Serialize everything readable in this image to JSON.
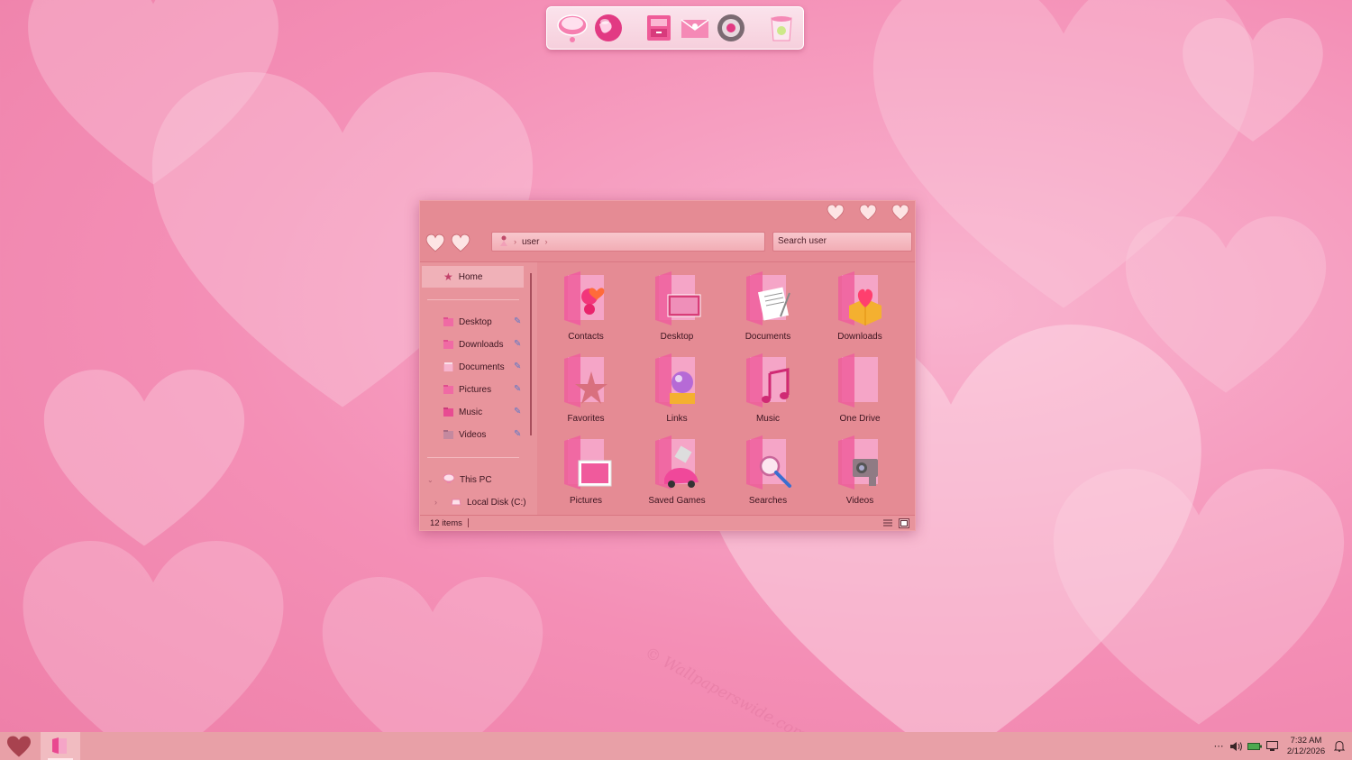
{
  "window": {
    "address": {
      "path": [
        "user"
      ]
    },
    "search": {
      "placeholder": "Search user"
    },
    "sidebar": {
      "home": "Home",
      "quick_access": [
        "Desktop",
        "Downloads",
        "Documents",
        "Pictures",
        "Music",
        "Videos"
      ],
      "this_pc": "This PC",
      "local_disk": "Local Disk (C:)"
    },
    "items": [
      "Contacts",
      "Desktop",
      "Documents",
      "Downloads",
      "Favorites",
      "Links",
      "Music",
      "One Drive",
      "Pictures",
      "Saved Games",
      "Searches",
      "Videos"
    ],
    "status": {
      "count": "12 items"
    }
  },
  "dock": {
    "icons": [
      "chat-icon",
      "globe-icon",
      "cabinet-icon",
      "mail-icon",
      "settings-disc-icon",
      "trash-icon"
    ]
  },
  "taskbar": {
    "tray": {
      "overflow": "⋯",
      "time": "7:32 AM",
      "date": "2/12/2026"
    }
  },
  "wallpaper": {
    "watermark": "© Wallpaperswide.com"
  },
  "colors": {
    "accent": "#e58b94",
    "wallpaper": "#f48fb6",
    "taskbar": "#e8a0a7"
  }
}
